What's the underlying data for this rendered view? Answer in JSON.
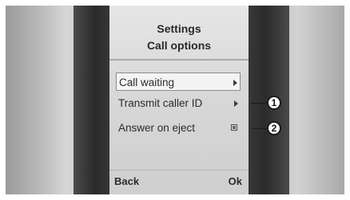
{
  "screen": {
    "title_line1": "Settings",
    "title_line2": "Call options"
  },
  "menu": {
    "items": [
      {
        "label": "Call waiting",
        "control": "arrow-icon",
        "selected": true
      },
      {
        "label": "Transmit caller ID",
        "control": "arrow-icon",
        "selected": false
      },
      {
        "label": "Answer on eject",
        "control": "checkbox-icon",
        "selected": false,
        "checked": true
      }
    ]
  },
  "softkeys": {
    "left": "Back",
    "right": "Ok"
  },
  "callouts": [
    "1",
    "2"
  ]
}
